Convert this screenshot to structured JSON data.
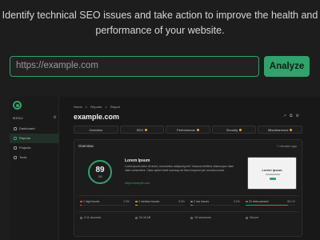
{
  "hero": {
    "line1": "Identify technical SEO issues and take action to improve the health and",
    "line2": "performance of your website."
  },
  "search": {
    "placeholder": "https://example.com",
    "button_label": "Analyze"
  },
  "colors": {
    "accent": "#2fa36b",
    "background": "#1d1d1d",
    "warning": "#d8a02a"
  },
  "preview": {
    "sidebar": {
      "menu_label": "MENU",
      "items": [
        {
          "label": "Dashboard",
          "active": false
        },
        {
          "label": "Reports",
          "active": true
        },
        {
          "label": "Projects",
          "active": false
        },
        {
          "label": "Tools",
          "active": false
        }
      ]
    },
    "breadcrumb": [
      "Home",
      ">",
      "Reports",
      ">",
      "Report"
    ],
    "title": "example.com",
    "tabs": [
      "Overview",
      "SEO",
      "Performance",
      "Security",
      "Miscellaneous"
    ],
    "overview": {
      "label": "Overview",
      "time_ago": "7 minutes ago",
      "score": "89",
      "score_max": "100",
      "heading": "Lorem Ipsum",
      "body": "Lorem ipsum dolor sit amet, consectetur adipiscing elit. Vivamus eleifend ullamcorper diam vitae consectetur. Class aptent taciti sociosqu ad litora torquent per conubia nostra.",
      "link": "https://example.com",
      "thumbnail_title": "Lorem ipsum"
    },
    "stats": [
      {
        "label": "1 high issues",
        "pct": "2.8%",
        "color": "#e05555",
        "fill": 0.028
      },
      {
        "label": "2 medium issues",
        "pct": "5.6%",
        "color": "#d8a02a",
        "fill": 0.056
      },
      {
        "label": "2 low issues",
        "pct": "5.6%",
        "color": "#888888",
        "fill": 0.056
      },
      {
        "label": "31 tests passed",
        "pct": "86.1%",
        "color": "#2fa36b",
        "fill": 0.861
      }
    ],
    "meta": [
      "0.11 seconds",
      "54.16 kB",
      "15 resources",
      "Secure"
    ]
  }
}
